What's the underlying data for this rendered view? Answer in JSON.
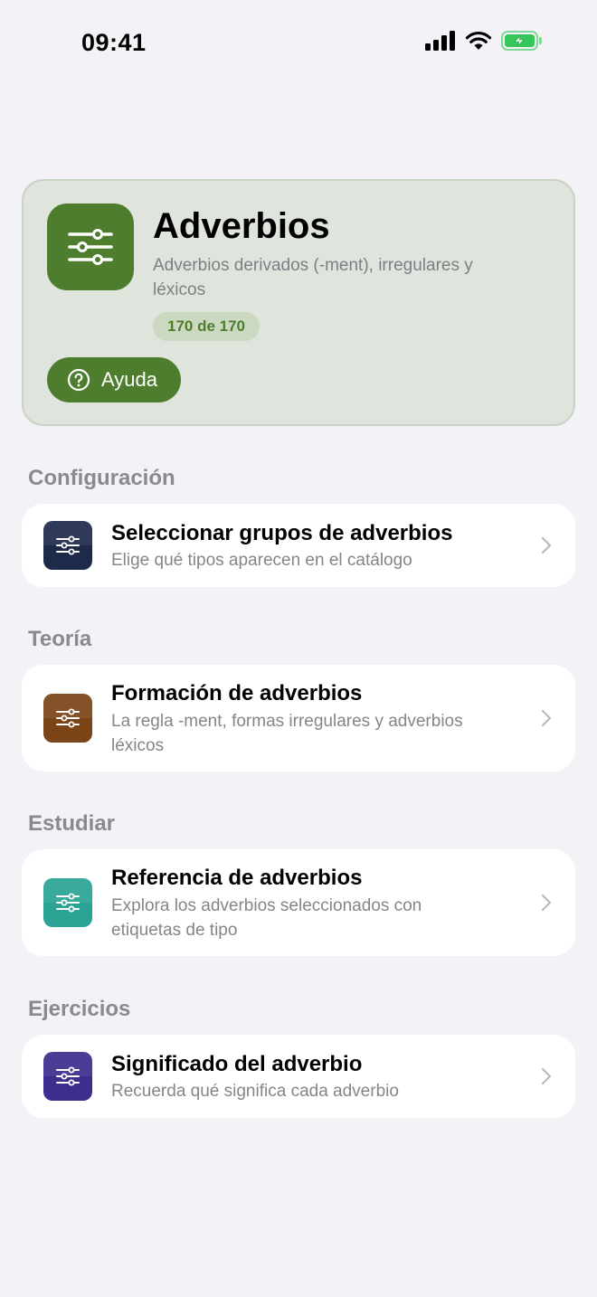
{
  "status_bar": {
    "time": "09:41"
  },
  "header": {
    "title": "Adverbios",
    "subtitle": "Adverbios derivados (-ment), irregulares y léxicos",
    "count_badge": "170 de 170",
    "help_label": "Ayuda",
    "accent_color": "#4e7d2e"
  },
  "sections": [
    {
      "title": "Configuración",
      "item": {
        "title": "Seleccionar grupos de adverbios",
        "subtitle": "Elige qué tipos aparecen en el catálogo",
        "icon": "sliders-icon",
        "color": "#1e2a4a"
      }
    },
    {
      "title": "Teoría",
      "item": {
        "title": "Formación de adverbios",
        "subtitle": "La regla -ment, formas irregulares y adverbios léxicos",
        "icon": "sliders-icon",
        "color": "#7a4416"
      }
    },
    {
      "title": "Estudiar",
      "item": {
        "title": "Referencia de adverbios",
        "subtitle": "Explora los adverbios seleccionados con etiquetas de tipo",
        "icon": "sliders-icon",
        "color": "#2aa394"
      }
    },
    {
      "title": "Ejercicios",
      "item": {
        "title": "Significado del adverbio",
        "subtitle": "Recuerda qué significa cada adverbio",
        "icon": "sliders-icon",
        "color": "#3c2d8e"
      }
    }
  ]
}
